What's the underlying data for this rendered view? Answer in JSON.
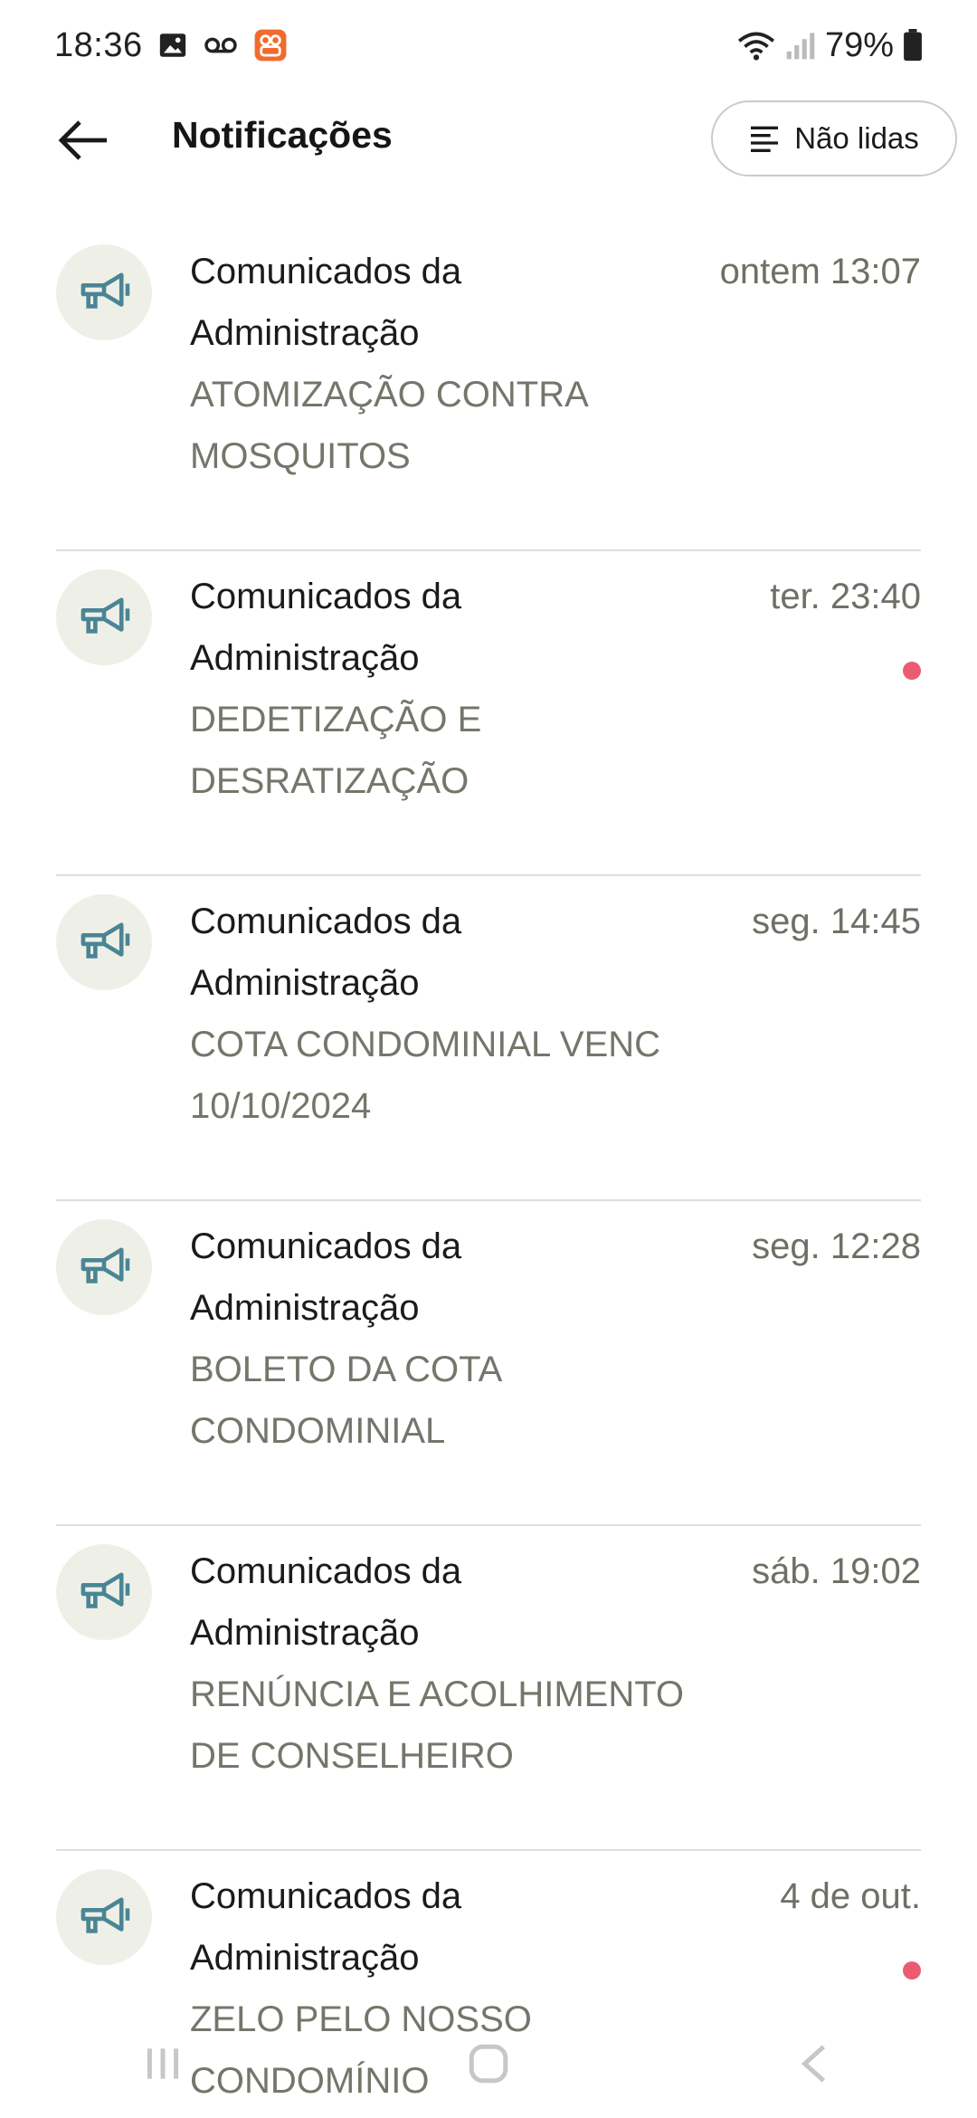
{
  "status_bar": {
    "time": "18:36",
    "battery": "79%",
    "icons": [
      "gallery-icon",
      "voicemail-icon",
      "app-notification-icon",
      "wifi-icon",
      "signal-icon",
      "battery-icon"
    ]
  },
  "header": {
    "title": "Notificações",
    "filter_label": "Não lidas"
  },
  "notifications": [
    {
      "sender": "Comunicados da Administração",
      "sender_line1": "Comunicados da",
      "sender_line2": "Administração",
      "subject_line1": "ATOMIZAÇÃO CONTRA",
      "subject_line2": "MOSQUITOS",
      "time": "ontem 13:07",
      "unread": false
    },
    {
      "sender": "Comunicados da Administração",
      "sender_line1": "Comunicados da",
      "sender_line2": "Administração",
      "subject_line1": "DEDETIZAÇÃO E",
      "subject_line2": "DESRATIZAÇÃO",
      "time": "ter. 23:40",
      "unread": true
    },
    {
      "sender": "Comunicados da Administração",
      "sender_line1": "Comunicados da",
      "sender_line2": "Administração",
      "subject_line1": "COTA CONDOMINIAL VENC",
      "subject_line2": "10/10/2024",
      "time": "seg. 14:45",
      "unread": false
    },
    {
      "sender": "Comunicados da Administração",
      "sender_line1": "Comunicados da",
      "sender_line2": "Administração",
      "subject_line1": "BOLETO DA COTA",
      "subject_line2": "CONDOMINIAL",
      "time": "seg. 12:28",
      "unread": false
    },
    {
      "sender": "Comunicados da Administração",
      "sender_line1": "Comunicados da",
      "sender_line2": "Administração",
      "subject_line1": "RENÚNCIA E ACOLHIMENTO",
      "subject_line2": "DE CONSELHEIRO",
      "time": "sáb. 19:02",
      "unread": false
    },
    {
      "sender": "Comunicados da Administração",
      "sender_line1": "Comunicados da",
      "sender_line2": "Administração",
      "subject_line1": "ZELO PELO NOSSO",
      "subject_line2": "CONDOMÍNIO",
      "time": "4 de out.",
      "unread": true
    }
  ],
  "colors": {
    "accent_icon": "#4a8595",
    "avatar_bg": "#eef0e7",
    "unread_dot": "#eb5c72",
    "subject_text": "#74766b",
    "notification_badge": "#f26a2e"
  }
}
